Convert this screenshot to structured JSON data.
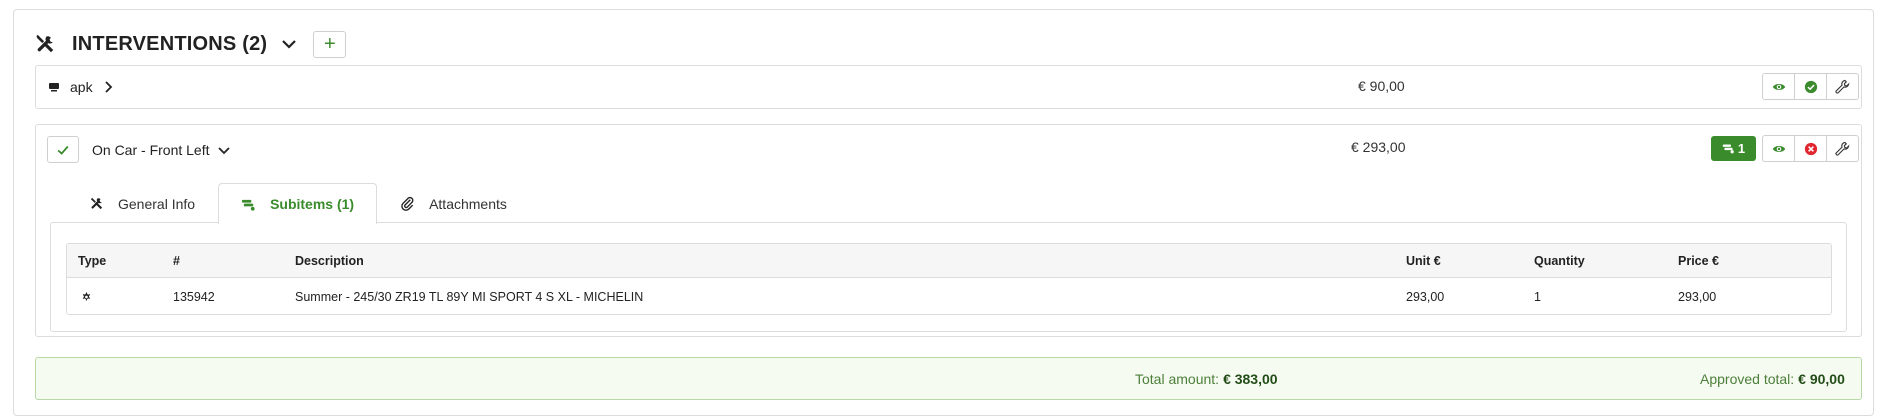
{
  "header": {
    "title": "INTERVENTIONS (2)",
    "add_label": "+"
  },
  "items": [
    {
      "label": "apk",
      "price": "€ 90,00",
      "actions": [
        "eye-icon",
        "check-circle-icon",
        "wrench-icon"
      ]
    },
    {
      "label": "On Car - Front Left",
      "price": "€ 293,00",
      "subitems_count": "1",
      "actions": [
        "eye-icon",
        "x-circle-icon",
        "wrench-icon"
      ],
      "tabs": [
        {
          "label": "General Info",
          "icon": "tools-icon"
        },
        {
          "label": "Subitems (1)",
          "icon": "tire-rack-icon",
          "active": true
        },
        {
          "label": "Attachments",
          "icon": "paperclip-icon"
        }
      ],
      "table": {
        "headers": [
          "Type",
          "#",
          "Description",
          "Unit €",
          "Quantity",
          "Price €"
        ],
        "rows": [
          {
            "type_icon": "gear-icon",
            "number": "135942",
            "description": "Summer - 245/30 ZR19 TL 89Y MI SPORT 4 S XL - MICHELIN",
            "unit": "293,00",
            "quantity": "1",
            "price": "293,00"
          }
        ]
      }
    }
  ],
  "totals": {
    "total_label": "Total amount:",
    "total_value": "€ 383,00",
    "approved_label": "Approved total:",
    "approved_value": "€ 90,00"
  },
  "colors": {
    "accent_green": "#3a8b2c",
    "danger_red": "#e0262e",
    "totals_bg": "#f6fbf1"
  }
}
